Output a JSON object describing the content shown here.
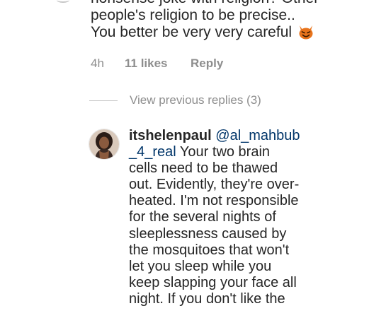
{
  "previous_comment": {
    "lines": [
      "nonsense joke with religion? Other",
      "people's religion to be precise..",
      "You better be very very careful"
    ],
    "emoji_icon": "smiling-devil-emoji",
    "time": "4h",
    "likes": "11 likes",
    "reply_label": "Reply"
  },
  "view_previous_replies": "View previous replies (3)",
  "reply": {
    "username": "itshelenpaul",
    "mention_line1": "@al_mahbub",
    "mention_line2": "_4_real",
    "body_lines": [
      " Your two brain",
      "cells need to be thawed",
      "out. Evidently, they're over-",
      "heated. I'm not responsible",
      "for the several nights of",
      "sleeplessness caused by",
      "the mosquitoes that won't",
      "let you sleep while you",
      "keep slapping your face all",
      "night. If you don't like the"
    ]
  },
  "colors": {
    "text": "#262626",
    "meta_gray": "#8e8e8e",
    "mention_blue": "#003569",
    "emoji_orange": "#e8741c"
  }
}
